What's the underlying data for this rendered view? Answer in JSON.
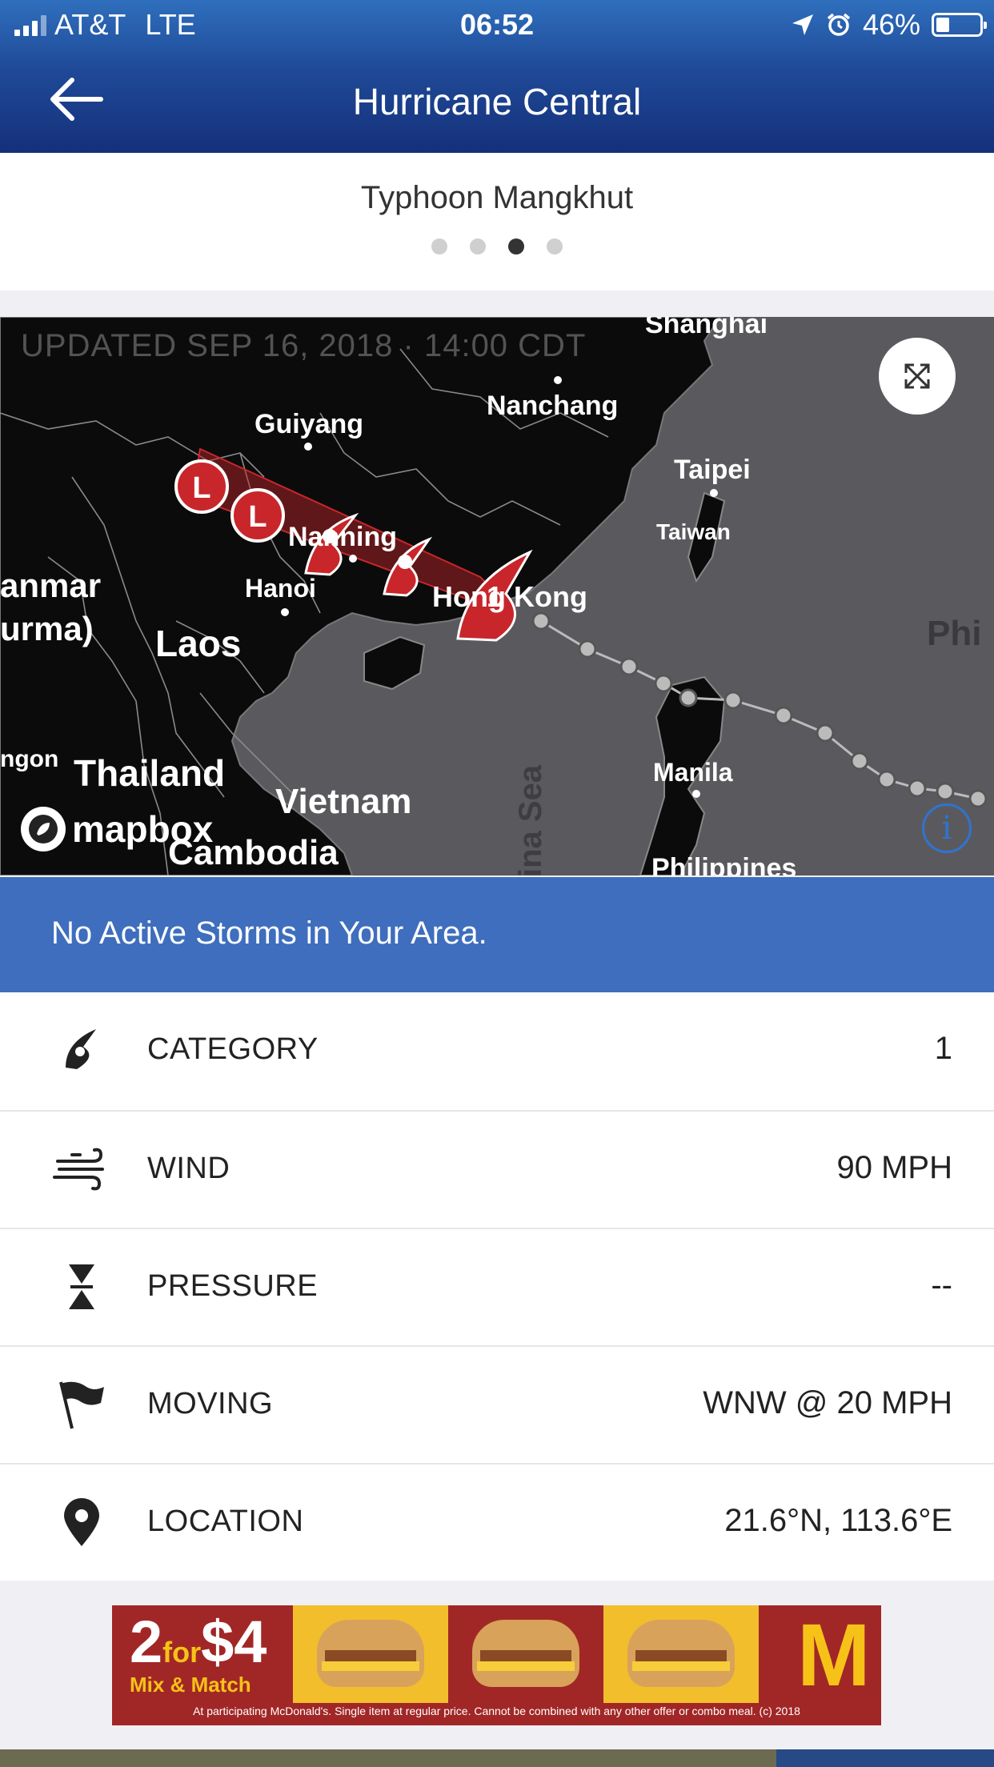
{
  "status_bar": {
    "carrier": "AT&T",
    "network": "LTE",
    "time": "06:52",
    "battery": "46%",
    "battery_level": 0.46
  },
  "nav": {
    "title": "Hurricane Central"
  },
  "storm": {
    "name": "Typhoon Mangkhut",
    "page_count": 4,
    "active_page": 3
  },
  "map": {
    "updated": "UPDATED SEP 16, 2018 · 14:00 CDT",
    "attribution": "mapbox",
    "storm_category_marker": "1",
    "place_labels": [
      "Shanghai",
      "Nanchang",
      "Guiyang",
      "Taipei",
      "Taiwan",
      "Nanning",
      "Hanoi",
      "Hong Kong",
      "Laos",
      "anmar",
      "urma)",
      "Thailand",
      "Vietnam",
      "Cambodia",
      "Manila",
      "Philippines",
      "ngon",
      "Phi",
      "ina Sea"
    ],
    "colors": {
      "land": "#0b0b0b",
      "water": "#5a5a5e",
      "track_marker": "#c8262b"
    }
  },
  "alert": {
    "text": "No Active Storms in Your Area.",
    "color": "#3e6ebd"
  },
  "details": [
    {
      "icon": "hurricane-icon",
      "label": "CATEGORY",
      "value": "1"
    },
    {
      "icon": "wind-icon",
      "label": "WIND",
      "value": "90 MPH"
    },
    {
      "icon": "pressure-icon",
      "label": "PRESSURE",
      "value": "--"
    },
    {
      "icon": "flag-icon",
      "label": "MOVING",
      "value": "WNW @ 20 MPH"
    },
    {
      "icon": "location-pin-icon",
      "label": "LOCATION",
      "value": "21.6°N, 113.6°E"
    }
  ],
  "ad": {
    "deal_number": "2",
    "deal_for": "for",
    "deal_price": "$4",
    "deal_name": "Mix & Match",
    "brand_mark": "M",
    "fine_print": "At participating McDonald's. Single item at regular price. Cannot be combined with any other offer or combo meal. (c) 2018"
  }
}
